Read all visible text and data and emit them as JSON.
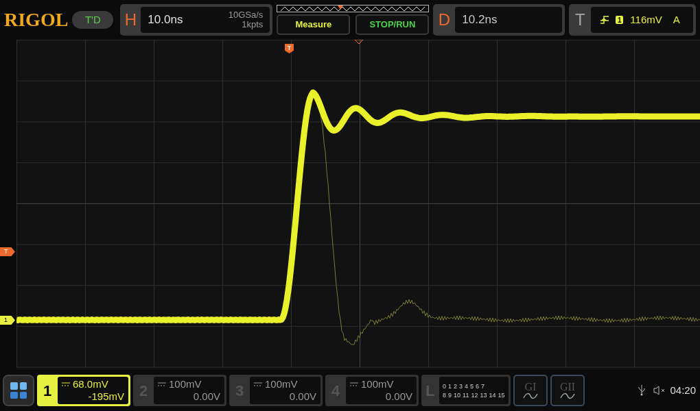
{
  "brand": "RIGOL",
  "mode_badge": "T'D",
  "horizontal": {
    "label": "H",
    "timebase": "10.0ns",
    "sample_rate": "10GSa/s",
    "memory_depth": "1kpts"
  },
  "buttons": [
    {
      "label": "Measure",
      "kind": "measure"
    },
    {
      "label": "STOP/RUN",
      "kind": "run"
    }
  ],
  "delay": {
    "label": "D",
    "value": "10.2ns"
  },
  "trigger": {
    "label": "T",
    "channel": "1",
    "level": "116mV",
    "mode": "A"
  },
  "top_marker": {
    "label": "T"
  },
  "left_markers": [
    {
      "label": "T",
      "kind": "trigger"
    },
    {
      "label": "1",
      "kind": "channel"
    }
  ],
  "channels": [
    {
      "number": "1",
      "scale": "68.0mV",
      "offset": "-195mV",
      "on": true
    },
    {
      "number": "2",
      "scale": "100mV",
      "offset": "0.00V",
      "on": false
    },
    {
      "number": "3",
      "scale": "100mV",
      "offset": "0.00V",
      "on": false
    },
    {
      "number": "4",
      "scale": "100mV",
      "offset": "0.00V",
      "on": false
    }
  ],
  "logic": {
    "label": "L",
    "row_1": [
      "0",
      "1",
      "2",
      "3",
      "4",
      "5",
      "6",
      "7"
    ],
    "row_2": [
      "8",
      "9",
      "10",
      "11",
      "12",
      "13",
      "14",
      "15"
    ]
  },
  "generators": [
    {
      "label": "GI"
    },
    {
      "label": "GII"
    }
  ],
  "status": {
    "time": "04:20"
  }
}
